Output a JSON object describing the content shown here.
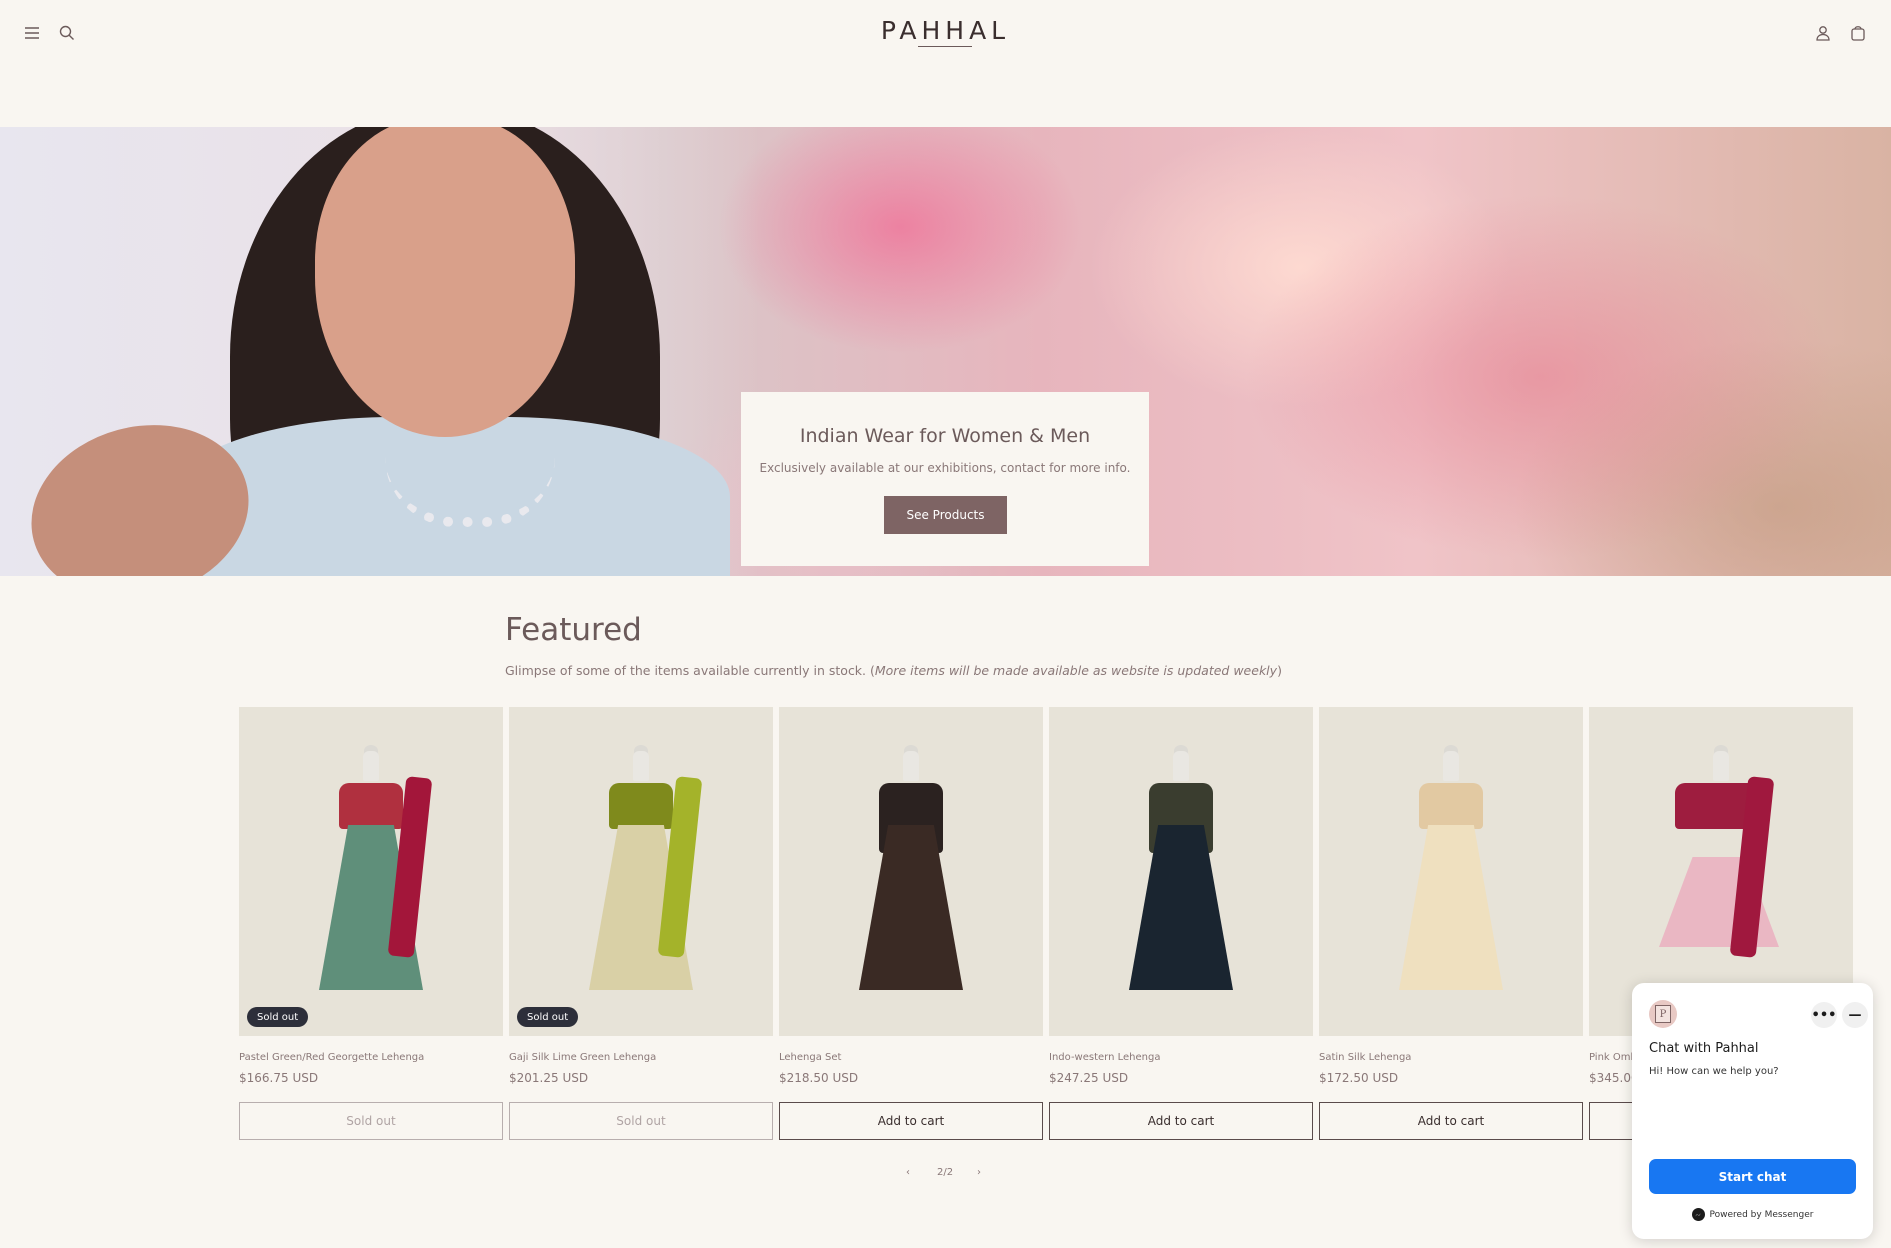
{
  "header": {
    "logo": "PAHHAL",
    "icons": [
      "menu-icon",
      "search-icon",
      "account-icon",
      "cart-icon"
    ]
  },
  "hero": {
    "title": "Indian Wear for Women & Men",
    "subtitle": "Exclusively available at our exhibitions, contact for more info.",
    "button": "See Products"
  },
  "featured": {
    "title": "Featured",
    "subtitle": "Glimpse of some of the items available currently in stock. (",
    "subtitle_italic": "More items will be made available as website is updated weekly",
    "subtitle_end": ")",
    "products": [
      {
        "name": "Pastel Green/Red Georgette Lehenga",
        "price": "$166.75 USD",
        "badge": "Sold out",
        "button": "Sold out",
        "top_color": "#b0303f",
        "skirt_color": "#5f8f7a",
        "dupatta_color": "#a3163a"
      },
      {
        "name": "Gaji Silk Lime Green Lehenga",
        "price": "$201.25 USD",
        "badge": "Sold out",
        "button": "Sold out",
        "top_color": "#7f8a1c",
        "skirt_color": "#d9d0a6",
        "dupatta_color": "#a4b32a"
      },
      {
        "name": "Lehenga Set",
        "price": "$218.50 USD",
        "badge": "",
        "button": "Add to cart",
        "top_color": "#2b2220",
        "skirt_color": "#3a2a24",
        "dupatta_color": ""
      },
      {
        "name": "Indo-western Lehenga",
        "price": "$247.25 USD",
        "badge": "",
        "button": "Add to cart",
        "top_color": "#3a3d2f",
        "skirt_color": "#1a2530",
        "dupatta_color": ""
      },
      {
        "name": "Satin Silk Lehenga",
        "price": "$172.50 USD",
        "badge": "",
        "button": "Add to cart",
        "top_color": "#e2c9a2",
        "skirt_color": "#efe0bf",
        "dupatta_color": ""
      },
      {
        "name": "Pink Omb",
        "price": "$345.00",
        "badge": "",
        "button": "",
        "top_color": "#9e1d3f",
        "skirt_color": "#eab7c3",
        "dupatta_color": "#a0183e"
      }
    ],
    "pager": {
      "prev": "‹",
      "label": "2/2",
      "next": "›"
    }
  },
  "chat": {
    "title": "Chat with Pahhal",
    "message": "Hi! How can we help you?",
    "start_button": "Start chat",
    "powered": "Powered by Messenger",
    "more": "•••",
    "minimize": "—",
    "avatar_letter": "P"
  }
}
